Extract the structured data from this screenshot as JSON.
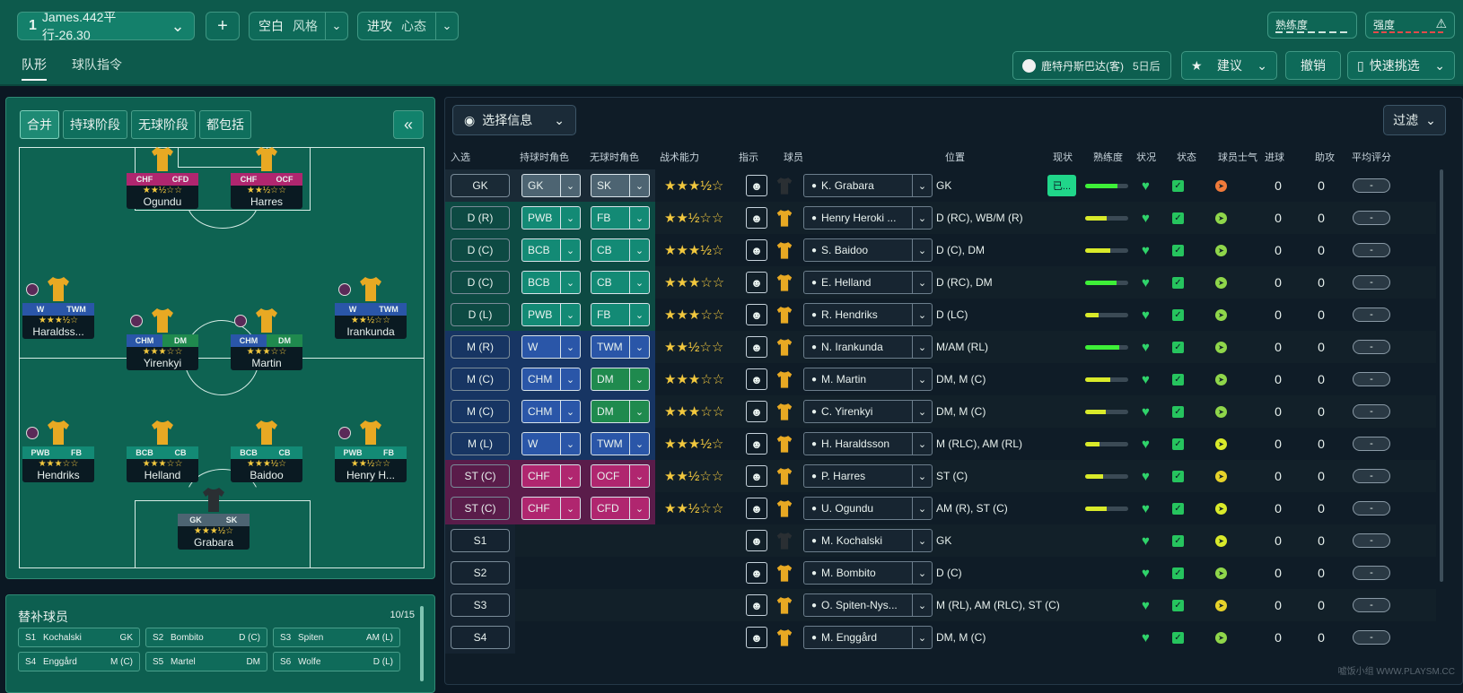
{
  "topbar": {
    "tactic_slot": "1",
    "tactic_name": "James.442平行-26.30",
    "add_label": "+",
    "style_left": "空白",
    "style_right": "风格",
    "mentality_left": "进攻",
    "mentality_right": "心态",
    "familiarity_label": "熟练度",
    "intensity_label": "强度",
    "tabs": [
      "队形",
      "球队指令"
    ],
    "next_match": "鹿特丹斯巴达(客)",
    "next_match_days": "5日后",
    "suggest_label": "建议",
    "undo_label": "撤销",
    "quick_pick_label": "快速挑选"
  },
  "pitch_panel": {
    "phases": [
      "合并",
      "持球阶段",
      "无球阶段",
      "都包括"
    ],
    "collapse_icon": "«",
    "players": [
      {
        "name": "Ogundu",
        "in": "CHF",
        "out": "CFD",
        "stars": "★★½☆☆",
        "color": "#b0266f"
      },
      {
        "name": "Harres",
        "in": "CHF",
        "out": "OCF",
        "stars": "★★½☆☆",
        "color": "#b0266f"
      },
      {
        "name": "Haraldss...",
        "in": "W",
        "out": "TWM",
        "stars": "★★★½☆",
        "color": "#2a56a8"
      },
      {
        "name": "Yirenkyi",
        "in": "CHM",
        "out": "DM",
        "stars": "★★★☆☆",
        "color": "#2a56a8"
      },
      {
        "name": "Martin",
        "in": "CHM",
        "out": "DM",
        "stars": "★★★☆☆",
        "color": "#2a56a8"
      },
      {
        "name": "Irankunda",
        "in": "W",
        "out": "TWM",
        "stars": "★★½☆☆",
        "color": "#2a56a8"
      },
      {
        "name": "Hendriks",
        "in": "PWB",
        "out": "FB",
        "stars": "★★★☆☆",
        "color": "#138a75"
      },
      {
        "name": "Helland",
        "in": "BCB",
        "out": "CB",
        "stars": "★★★☆☆",
        "color": "#138a75"
      },
      {
        "name": "Baidoo",
        "in": "BCB",
        "out": "CB",
        "stars": "★★★½☆",
        "color": "#138a75"
      },
      {
        "name": "Henry H...",
        "in": "PWB",
        "out": "FB",
        "stars": "★★½☆☆",
        "color": "#138a75"
      },
      {
        "name": "Grabara",
        "in": "GK",
        "out": "SK",
        "stars": "★★★½☆",
        "color": "#4d6472"
      }
    ]
  },
  "subs": {
    "title": "替补球员",
    "count": "10/15",
    "items": [
      {
        "n": "S1",
        "name": "Kochalski",
        "pos": "GK"
      },
      {
        "n": "S2",
        "name": "Bombito",
        "pos": "D (C)"
      },
      {
        "n": "S3",
        "name": "Spiten",
        "pos": "AM (L)"
      },
      {
        "n": "S4",
        "name": "Enggård",
        "pos": "M (C)"
      },
      {
        "n": "S5",
        "name": "Martel",
        "pos": "DM"
      },
      {
        "n": "S6",
        "name": "Wolfe",
        "pos": "D (L)"
      }
    ]
  },
  "table": {
    "select_info": "选择信息",
    "filter": "过滤",
    "headers": [
      "入选",
      "持球时角色",
      "无球时角色",
      "战术能力",
      "指示",
      "球员",
      "位置",
      "现状",
      "熟练度",
      "状况",
      "状态",
      "球员士气",
      "进球",
      "助攻",
      "平均评分"
    ],
    "rows": [
      {
        "pos": "GK",
        "in": "GK",
        "out": "SK",
        "stars": "★★★½☆",
        "player": "K. Grabara",
        "positions": "GK",
        "fam": 0.75,
        "famc": "#3ef038",
        "goals": "0",
        "assists": "0",
        "avg": "-",
        "mor": "#f07a3a",
        "con": "已..."
      },
      {
        "pos": "D (R)",
        "in": "PWB",
        "out": "FB",
        "stars": "★★½☆☆",
        "player": "Henry Heroki ...",
        "positions": "D (RC), WB/M (R)",
        "fam": 0.5,
        "famc": "#d9ea2a",
        "goals": "0",
        "assists": "0",
        "avg": "-",
        "mor": "#8fd64a"
      },
      {
        "pos": "D (C)",
        "in": "BCB",
        "out": "CB",
        "stars": "★★★½☆",
        "player": "S. Baidoo",
        "positions": "D (C), DM",
        "fam": 0.58,
        "famc": "#d9ea2a",
        "goals": "0",
        "assists": "0",
        "avg": "-",
        "mor": "#8fd64a"
      },
      {
        "pos": "D (C)",
        "in": "BCB",
        "out": "CB",
        "stars": "★★★☆☆",
        "player": "E. Helland",
        "positions": "D (RC), DM",
        "fam": 0.72,
        "famc": "#3ef038",
        "goals": "0",
        "assists": "0",
        "avg": "-",
        "mor": "#8fd64a"
      },
      {
        "pos": "D (L)",
        "in": "PWB",
        "out": "FB",
        "stars": "★★★☆☆",
        "player": "R. Hendriks",
        "positions": "D (LC)",
        "fam": 0.32,
        "famc": "#d9ea2a",
        "goals": "0",
        "assists": "0",
        "avg": "-",
        "mor": "#8fd64a"
      },
      {
        "pos": "M (R)",
        "in": "W",
        "out": "TWM",
        "stars": "★★½☆☆",
        "player": "N. Irankunda",
        "positions": "M/AM (RL)",
        "fam": 0.8,
        "famc": "#3ef038",
        "goals": "0",
        "assists": "0",
        "avg": "-",
        "mor": "#8fd64a"
      },
      {
        "pos": "M (C)",
        "in": "CHM",
        "out": "DM",
        "stars": "★★★☆☆",
        "player": "M. Martin",
        "positions": "DM, M (C)",
        "fam": 0.58,
        "famc": "#d9ea2a",
        "goals": "0",
        "assists": "0",
        "avg": "-",
        "mor": "#8fd64a"
      },
      {
        "pos": "M (C)",
        "in": "CHM",
        "out": "DM",
        "stars": "★★★☆☆",
        "player": "C. Yirenkyi",
        "positions": "DM, M (C)",
        "fam": 0.48,
        "famc": "#d9ea2a",
        "goals": "0",
        "assists": "0",
        "avg": "-",
        "mor": "#8fd64a"
      },
      {
        "pos": "M (L)",
        "in": "W",
        "out": "TWM",
        "stars": "★★★½☆",
        "player": "H. Haraldsson",
        "positions": "M (RLC), AM (RL)",
        "fam": 0.34,
        "famc": "#d9ea2a",
        "goals": "0",
        "assists": "0",
        "avg": "-",
        "mor": "#d9ea2a"
      },
      {
        "pos": "ST (C)",
        "in": "CHF",
        "out": "OCF",
        "stars": "★★½☆☆",
        "player": "P. Harres",
        "positions": "ST (C)",
        "fam": 0.42,
        "famc": "#d9ea2a",
        "goals": "0",
        "assists": "0",
        "avg": "-",
        "mor": "#e6d22a"
      },
      {
        "pos": "ST (C)",
        "in": "CHF",
        "out": "CFD",
        "stars": "★★½☆☆",
        "player": "U. Ogundu",
        "positions": "AM (R), ST (C)",
        "fam": 0.5,
        "famc": "#d9ea2a",
        "goals": "0",
        "assists": "0",
        "avg": "-",
        "mor": "#d9ea2a"
      },
      {
        "pos": "S1",
        "player": "M. Kochalski",
        "positions": "GK",
        "goals": "0",
        "assists": "0",
        "avg": "-",
        "mor": "#d9ea2a"
      },
      {
        "pos": "S2",
        "player": "M. Bombito",
        "positions": "D (C)",
        "goals": "0",
        "assists": "0",
        "avg": "-",
        "mor": "#8fd64a"
      },
      {
        "pos": "S3",
        "player": "O. Spiten-Nys...",
        "positions": "M (RL), AM (RLC), ST (C)",
        "goals": "0",
        "assists": "0",
        "avg": "-",
        "mor": "#e6d22a"
      },
      {
        "pos": "S4",
        "player": "M. Enggård",
        "positions": "DM, M (C)",
        "goals": "0",
        "assists": "0",
        "avg": "-",
        "mor": "#8fd64a"
      }
    ]
  },
  "watermark": "嘘饭小组 WWW.PLAYSM.CC"
}
